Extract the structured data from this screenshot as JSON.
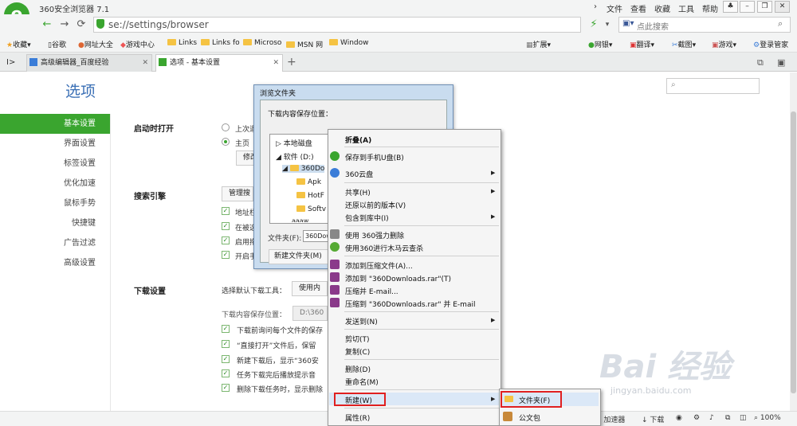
{
  "window": {
    "title": "360安全浏览器 7.1",
    "menu": [
      "文件",
      "查看",
      "收藏",
      "工具",
      "帮助"
    ],
    "logo_letter": "e"
  },
  "address": {
    "url": "se://settings/browser",
    "search_placeholder": "点此搜索"
  },
  "bookmarks": [
    "收藏",
    "谷歌",
    "网址大全",
    "游戏中心",
    "Links",
    "Links fo",
    "Microso",
    "MSN 网",
    "Window"
  ],
  "bookmarks_right": [
    "扩展",
    "网银",
    "翻译",
    "截图",
    "游戏",
    "登录管家"
  ],
  "tabs": [
    {
      "label": "高级编辑器_百度经验"
    },
    {
      "label": "选项 - 基本设置"
    }
  ],
  "tab_new": "+",
  "page": {
    "title": "选项"
  },
  "sidebar": [
    "基本设置",
    "界面设置",
    "标签设置",
    "优化加速",
    "鼠标手势",
    "快捷键",
    "广告过滤",
    "高级设置"
  ],
  "sections": {
    "startup": {
      "title": "启动时打开",
      "opt1": "上次退",
      "opt2": "主页",
      "btn": "修改"
    },
    "search": {
      "title": "搜索引擎",
      "btn": "管理搜",
      "checks": [
        "地址栏",
        "在被选",
        "启用拖",
        "开启手"
      ]
    },
    "download": {
      "title": "下载设置",
      "tool_label": "选择默认下载工具：",
      "tool_btn": "使用内置",
      "path_label": "下载内容保存位置：",
      "path_value": "D:\\360安",
      "checks": [
        "下载前询问每个文件的保存",
        "“直接打开”文件后，保留",
        "新建下载后，显示“360安",
        "任务下载完后播放提示音",
        "删除下载任务时，显示删除"
      ]
    }
  },
  "dialog": {
    "title": "浏览文件夹",
    "prompt": "下载内容保存位置：",
    "tree": [
      "本地磁盘",
      "软件 (D:)",
      "360Do",
      "Apk",
      "HotF",
      "Softv",
      "aaaw"
    ],
    "folder_label": "文件夹(F):",
    "folder_value": "360Dow",
    "new_folder": "新建文件夹(M)"
  },
  "context_menu": [
    "折叠(A)",
    "保存到手机U盘(B)",
    "360云盘",
    "共享(H)",
    "还原以前的版本(V)",
    "包含到库中(I)",
    "使用 360强力删除",
    "使用360进行木马云查杀",
    "添加到压缩文件(A)...",
    "添加到 \"360Downloads.rar\"(T)",
    "压缩并 E-mail...",
    "压缩到 \"360Downloads.rar\" 并 E-mail",
    "发送到(N)",
    "剪切(T)",
    "复制(C)",
    "删除(D)",
    "重命名(M)",
    "新建(W)",
    "属性(R)"
  ],
  "submenu": [
    "文件夹(F)",
    "公文包"
  ],
  "status": [
    "加速器",
    "下载",
    "100%"
  ],
  "watermark": {
    "brand": "Bai 经验",
    "url": "jingyan.baidu.com"
  },
  "colors": {
    "accent": "#3aa52f",
    "link": "#3a6fb5",
    "highlight": "#e02020"
  }
}
